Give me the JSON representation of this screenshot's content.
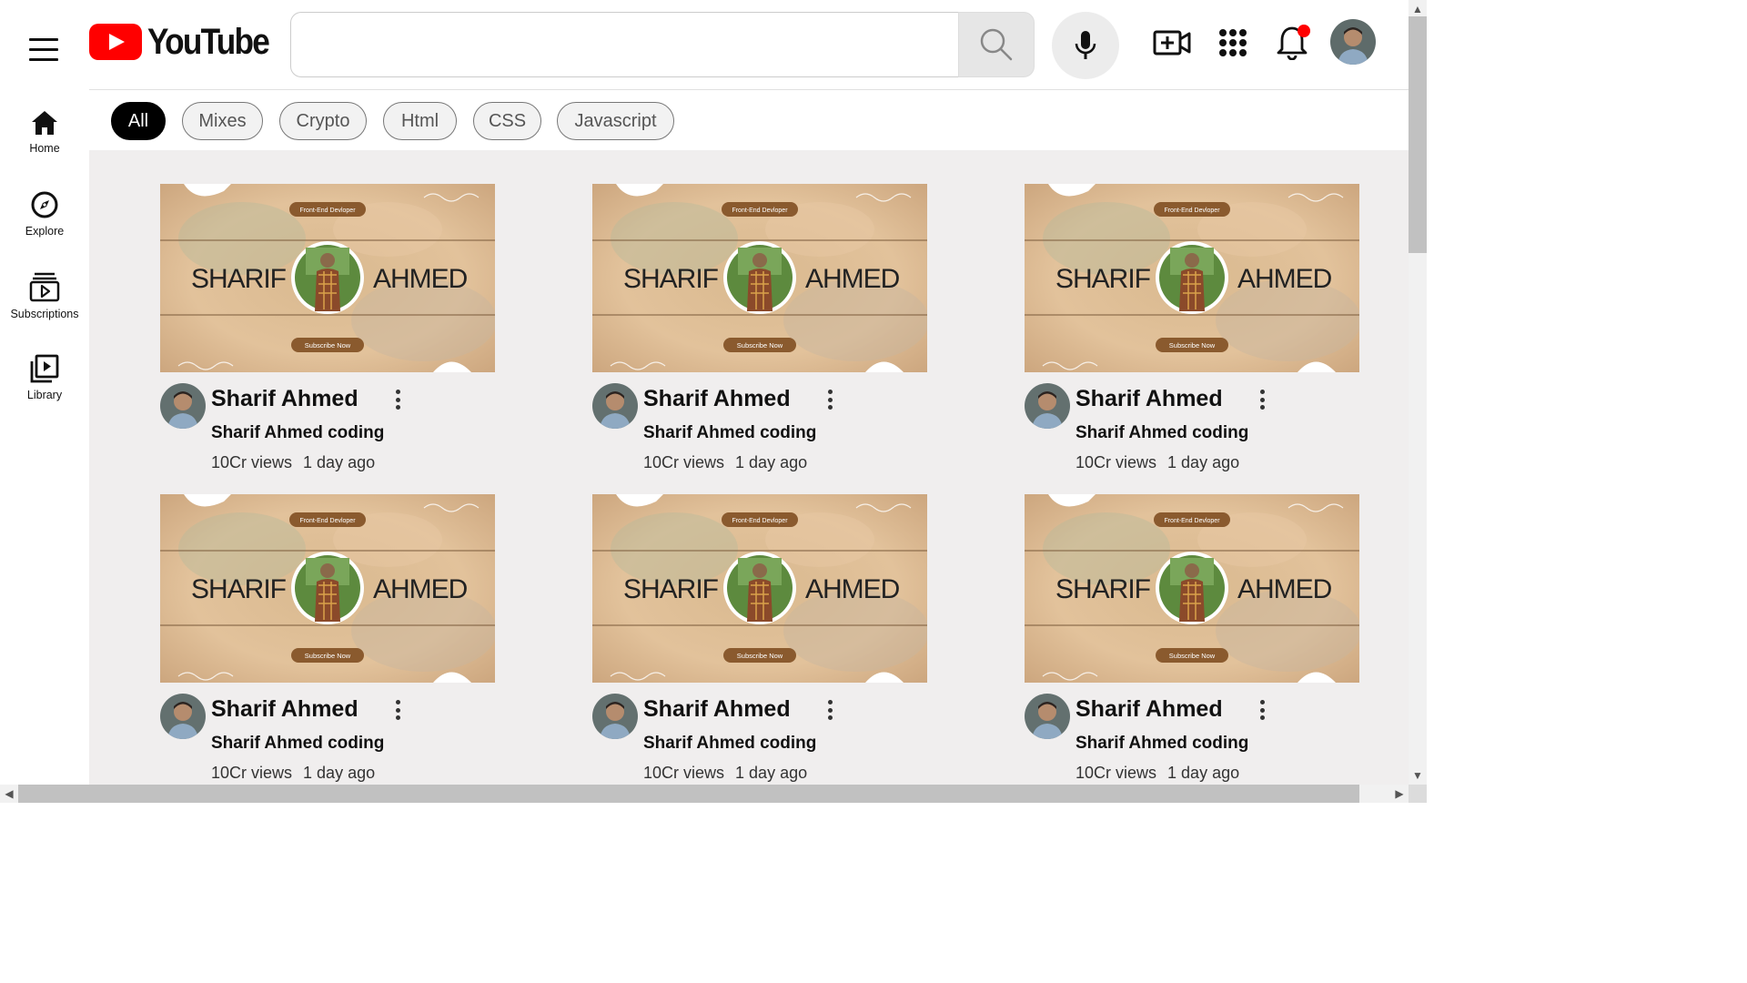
{
  "header": {
    "logo_text": "YouTube",
    "search_placeholder": "",
    "icons": [
      "menu-icon",
      "search-icon",
      "microphone-icon",
      "create-video-icon",
      "apps-grid-icon",
      "bell-icon"
    ]
  },
  "sidebar": {
    "items": [
      {
        "label": "Home",
        "icon": "home-icon"
      },
      {
        "label": "Explore",
        "icon": "compass-icon"
      },
      {
        "label": "Subscriptions",
        "icon": "subscriptions-icon"
      },
      {
        "label": "Library",
        "icon": "library-icon"
      }
    ]
  },
  "chips": [
    "All",
    "Mixes",
    "Crypto",
    "Html",
    "CSS",
    "Javascript"
  ],
  "thumbnail": {
    "top_badge": "Front-End Devloper",
    "name_left": "SHARIF",
    "name_right": "AHMED",
    "bottom_badge": "Subscribe Now"
  },
  "videos": [
    {
      "title": "Sharif Ahmed",
      "channel": "Sharif Ahmed coding",
      "views": "10Cr views",
      "age": "1 day ago"
    },
    {
      "title": "Sharif Ahmed",
      "channel": "Sharif Ahmed coding",
      "views": "10Cr views",
      "age": "1 day ago"
    },
    {
      "title": "Sharif Ahmed",
      "channel": "Sharif Ahmed coding",
      "views": "10Cr views",
      "age": "1 day ago"
    },
    {
      "title": "Sharif Ahmed",
      "channel": "Sharif Ahmed coding",
      "views": "10Cr views",
      "age": "1 day ago"
    },
    {
      "title": "Sharif Ahmed",
      "channel": "Sharif Ahmed coding",
      "views": "10Cr views",
      "age": "1 day ago"
    },
    {
      "title": "Sharif Ahmed",
      "channel": "Sharif Ahmed coding",
      "views": "10Cr views",
      "age": "1 day ago"
    }
  ],
  "colors": {
    "brand_red": "#ff0000",
    "content_bg": "#f0eeee",
    "chip_active": "#000000",
    "thumb_badge": "#8a5a2e"
  }
}
